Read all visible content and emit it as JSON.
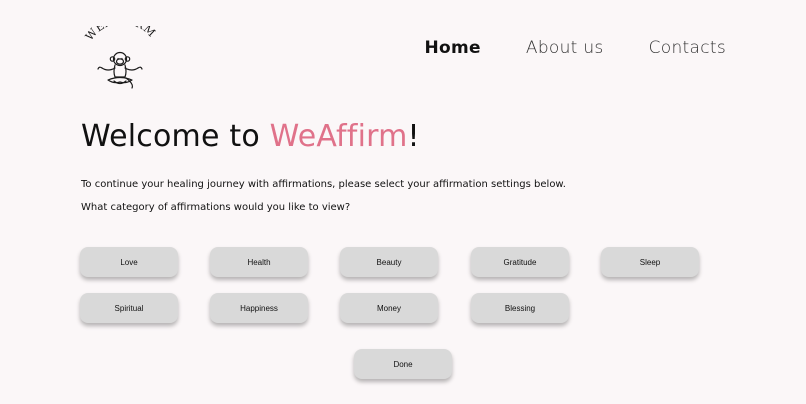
{
  "logo": {
    "text": "WEAFFIRM",
    "icon": "meditating-monkey-icon"
  },
  "nav": {
    "home": "Home",
    "about": "About us",
    "contacts": "Contacts",
    "active": "Home"
  },
  "main": {
    "headline_prefix": "Welcome to ",
    "headline_brand": "WeAffirm",
    "headline_suffix": "!",
    "intro": "To continue your healing journey with affirmations, please select your affirmation settings below.",
    "question": "What category of affirmations would you like to view?"
  },
  "categories": [
    "Love",
    "Health",
    "Beauty",
    "Gratitude",
    "Sleep",
    "Spiritual",
    "Happiness",
    "Money",
    "Blessing"
  ],
  "done_label": "Done",
  "colors": {
    "background": "#fbf7f8",
    "brand_accent": "#e0728a",
    "button_bg": "#d9d9d9",
    "text": "#111111"
  }
}
